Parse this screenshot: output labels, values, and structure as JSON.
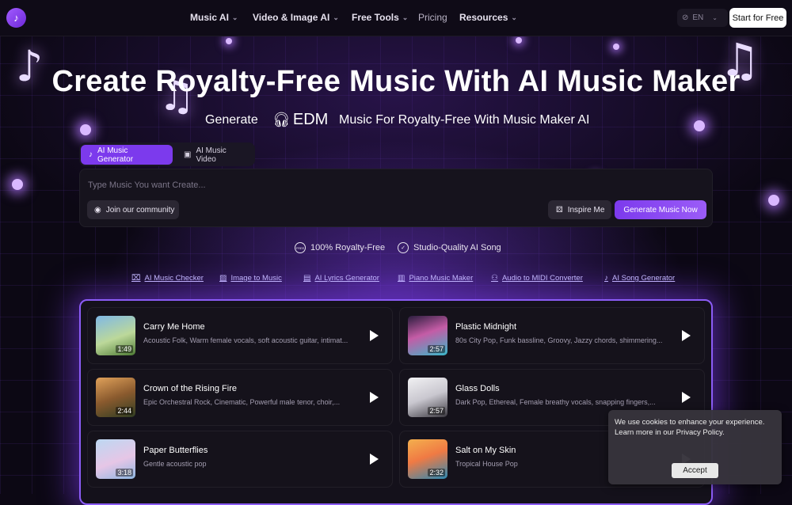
{
  "nav": {
    "items": [
      {
        "label": "Music AI",
        "dropdown": true
      },
      {
        "label": "Video & Image AI",
        "dropdown": true
      },
      {
        "label": "Free Tools",
        "dropdown": true
      },
      {
        "label": "Pricing",
        "dropdown": false
      },
      {
        "label": "Resources",
        "dropdown": true
      }
    ],
    "language": "EN",
    "start_button": "Start for Free"
  },
  "hero": {
    "title": "Create Royalty-Free Music With AI Music Maker",
    "sub_prefix": "Generate",
    "genre": "EDM",
    "sub_suffix": "Music For Royalty-Free With Music Maker AI"
  },
  "tabs": [
    "AI Music Generator",
    "AI Music Video"
  ],
  "prompt": {
    "placeholder": "Type Music You want Create...",
    "value": "",
    "community_button": "Join our community",
    "inspire_button": "Inspire Me",
    "generate_button": "Generate Music Now"
  },
  "badges": [
    {
      "icon_text": "FREE",
      "label": "100% Royalty-Free"
    },
    {
      "icon_text": "✓",
      "label": "Studio-Quality AI Song"
    }
  ],
  "tool_links": [
    "AI Music Checker",
    "Image to Music",
    "AI Lyrics Generator",
    "Piano Music Maker",
    "Audio to MIDI Converter",
    "AI Song Generator"
  ],
  "songs": [
    {
      "title": "Carry Me Home",
      "desc": "Acoustic Folk, Warm female vocals, soft acoustic guitar, intimat...",
      "duration": "1:49"
    },
    {
      "title": "Plastic Midnight",
      "desc": "80s City Pop, Funk bassline, Groovy, Jazzy chords, shimmering...",
      "duration": "2:57"
    },
    {
      "title": "Crown of the Rising Fire",
      "desc": "Epic Orchestral Rock, Cinematic, Powerful male tenor, choir,...",
      "duration": "2:44"
    },
    {
      "title": "Glass Dolls",
      "desc": "Dark Pop, Ethereal, Female breathy vocals, snapping fingers,...",
      "duration": "2:57"
    },
    {
      "title": "Paper Butterflies",
      "desc": "Gentle acoustic pop",
      "duration": "3:18"
    },
    {
      "title": "Salt on My Skin",
      "desc": "Tropical House Pop",
      "duration": "2:32"
    }
  ],
  "cookie": {
    "text": "We use cookies to enhance your experience. Learn more in our Privacy Policy.",
    "accept": "Accept"
  },
  "colors": {
    "accent": "#7c3aed",
    "background": "#0c0814",
    "link": "#c9c2ff"
  }
}
